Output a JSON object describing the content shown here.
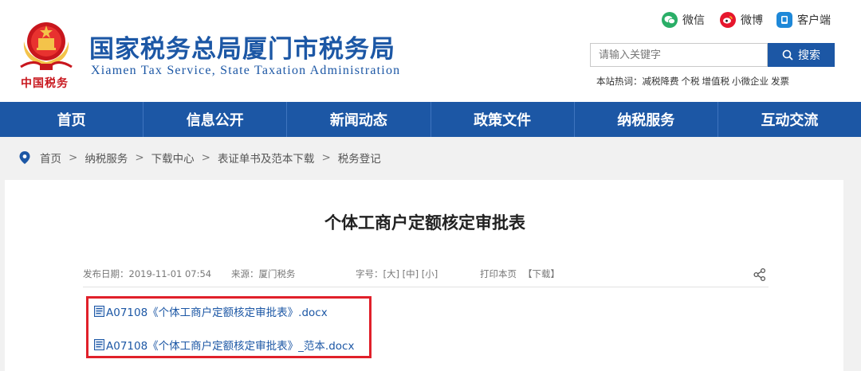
{
  "header": {
    "emblem_text": "中国税务",
    "title": "国家税务总局厦门市税务局",
    "subtitle": "Xiamen Tax Service, State Taxation Administration"
  },
  "social": {
    "wechat": "微信",
    "weibo": "微博",
    "client": "客户端"
  },
  "search": {
    "placeholder": "请输入关键字",
    "button_label": "搜索",
    "hot_label": "本站热词：",
    "hot_words": [
      "减税降费",
      "个税",
      "增值税",
      "小微企业",
      "发票"
    ]
  },
  "nav": {
    "items": [
      "首页",
      "信息公开",
      "新闻动态",
      "政策文件",
      "纳税服务",
      "互动交流"
    ]
  },
  "breadcrumb": {
    "items": [
      "首页",
      "纳税服务",
      "下载中心",
      "表证单书及范本下载",
      "税务登记"
    ],
    "separator": ">"
  },
  "article": {
    "title": "个体工商户定额核定审批表",
    "date": "发布日期：2019-11-01 07:54",
    "source": "来源：厦门税务",
    "font_size": "字号：[大] [中] [小]",
    "print": "打印本页",
    "download": "【下载】",
    "files": [
      "A07108《个体工商户定额核定审批表》.docx",
      "A07108《个体工商户定额核定审批表》_范本.docx"
    ]
  },
  "colors": {
    "brand_blue": "#1c57a5",
    "highlight_red": "#e0202a",
    "emblem_red": "#c8161d",
    "wechat_green": "#2aae67",
    "weibo_red": "#e6162d",
    "client_blue": "#1e88d8"
  },
  "icons": {
    "emblem": "national-emblem-icon",
    "wechat": "wechat-icon",
    "weibo": "weibo-icon",
    "client": "client-icon",
    "search": "search-icon",
    "breadcrumb": "location-pin-icon",
    "share": "share-icon",
    "file": "document-icon"
  }
}
